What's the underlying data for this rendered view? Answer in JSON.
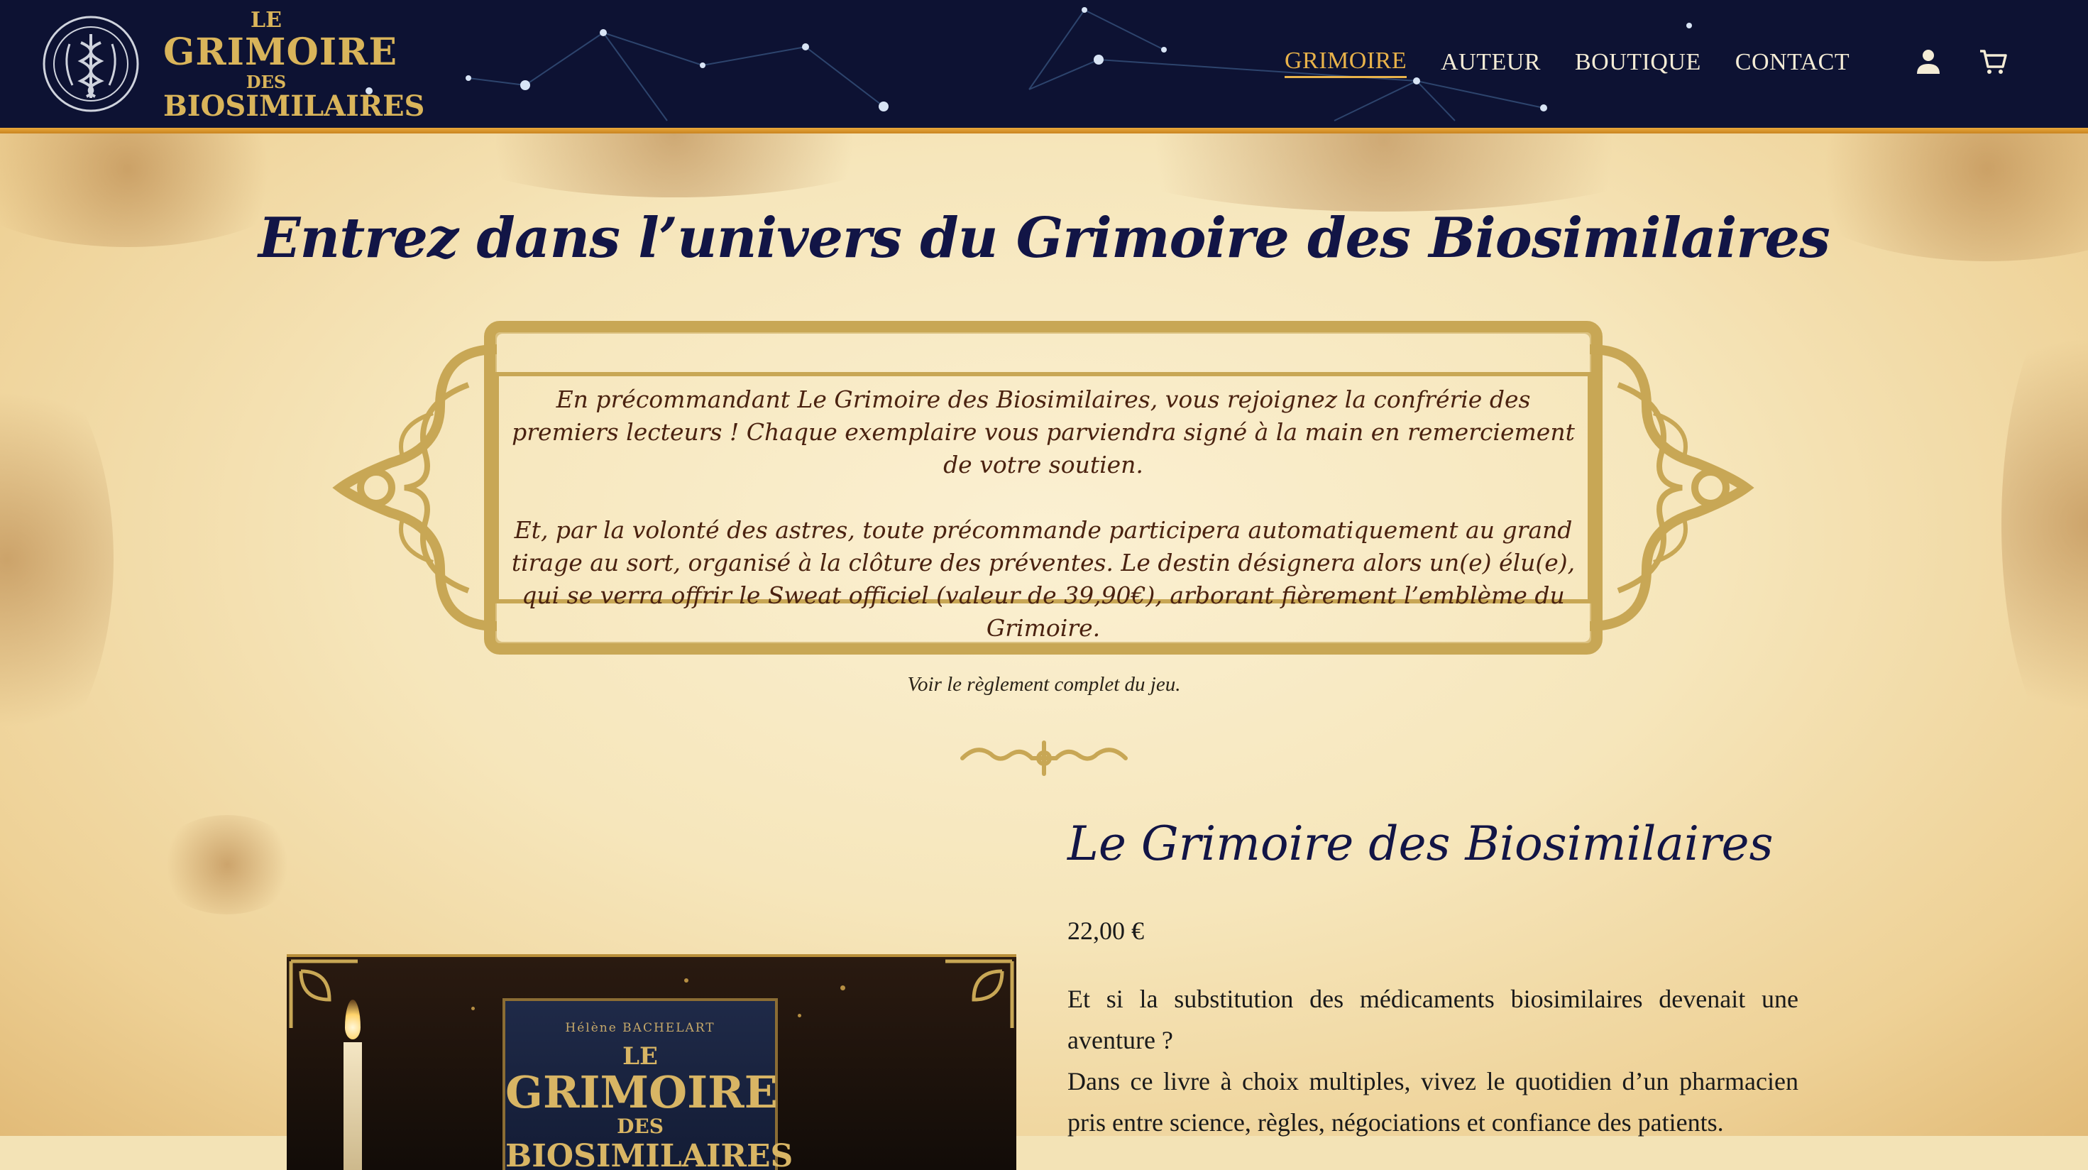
{
  "logo": {
    "line1": "LE",
    "line2": "GRIMOIRE",
    "line3": "DES",
    "line4": "BIOSIMILAIRES"
  },
  "nav": {
    "items": [
      {
        "label": "GRIMOIRE",
        "active": true
      },
      {
        "label": "AUTEUR",
        "active": false
      },
      {
        "label": "BOUTIQUE",
        "active": false
      },
      {
        "label": "CONTACT",
        "active": false
      }
    ],
    "icons": [
      "user-icon",
      "cart-icon"
    ]
  },
  "colors": {
    "header_bg": "#0d1233",
    "accent_gold": "#e8b24a",
    "title_navy": "#121546",
    "frame_gold": "#c8a755",
    "frame_text": "#4a2210"
  },
  "hero": {
    "title": "Entrez dans l’univers du Grimoire des Biosimilaires"
  },
  "announcement": {
    "paragraph1": "En précommandant Le Grimoire des Biosimilaires, vous rejoignez la confrérie des premiers lecteurs ! Chaque exemplaire vous parviendra signé à la main en remerciement de votre soutien.",
    "paragraph2": "Et, par la volonté des astres, toute précommande participera automatiquement au grand tirage au sort, organisé à la clôture des préventes. Le destin désignera alors un(e) élu(e), qui se verra offrir le Sweat officiel (valeur de 39,90€), arborant fièrement l’emblème du Grimoire."
  },
  "rules_link": "Voir le règlement complet du jeu.",
  "product": {
    "title": "Le Grimoire des Biosimilaires",
    "price": "22,00 €",
    "description_line1": "Et si la substitution des médicaments biosimilaires devenait une aventure ?",
    "description_line2": "Dans ce livre à choix multiples, vivez le quotidien d’un pharmacien pris entre science, règles, négociations et confiance des patients.",
    "cover": {
      "author": "Hélène BACHELART",
      "line1": "LE",
      "line2": "GRIMOIRE",
      "line3": "DES",
      "line4": "BIOSIMILAIRES"
    }
  }
}
